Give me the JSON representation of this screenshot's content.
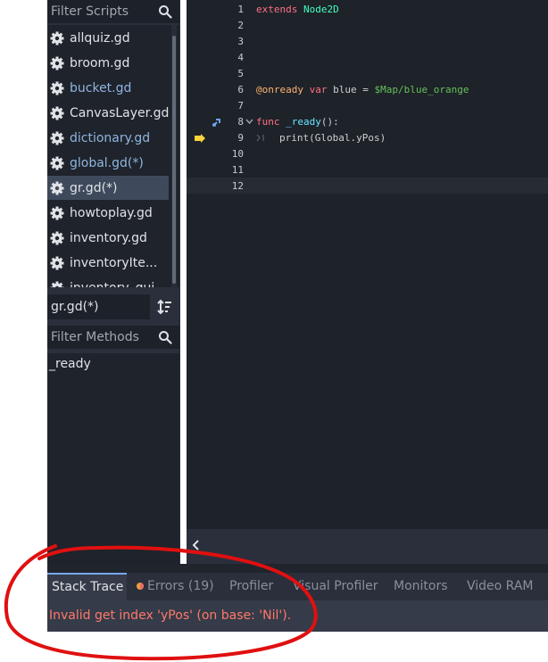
{
  "scripts_panel": {
    "filter_placeholder": "Filter Scripts",
    "items": [
      {
        "label": "allquiz.gd",
        "color": "white"
      },
      {
        "label": "broom.gd",
        "color": "white"
      },
      {
        "label": "bucket.gd",
        "color": "blue"
      },
      {
        "label": "CanvasLayer.gd",
        "color": "white"
      },
      {
        "label": "dictionary.gd",
        "color": "blue"
      },
      {
        "label": "global.gd(*)",
        "color": "blue"
      },
      {
        "label": "gr.gd(*)",
        "color": "white",
        "selected": true
      },
      {
        "label": "howtoplay.gd",
        "color": "white"
      },
      {
        "label": "inventory.gd",
        "color": "white"
      },
      {
        "label": "inventoryIte...",
        "color": "white"
      },
      {
        "label": "inventory_gui",
        "color": "white"
      }
    ],
    "current_script": "gr.gd(*)",
    "methods_filter_placeholder": "Filter Methods",
    "methods": [
      "_ready"
    ]
  },
  "editor": {
    "line_numbers": [
      "1",
      "2",
      "3",
      "4",
      "5",
      "6",
      "7",
      "8",
      "9",
      "10",
      "11",
      "12"
    ],
    "line1": {
      "kw": "extends",
      "cls": "Node2D"
    },
    "line6": {
      "annot": "@onready",
      "kw": "var",
      "name": "blue",
      "eq": "=",
      "path": "$Map/blue_orange"
    },
    "line8": {
      "kw": "func",
      "fname": "_ready",
      "rest": "():"
    },
    "line9": {
      "code": "print(Global.yPos)"
    }
  },
  "bottom_panel": {
    "tabs": [
      {
        "label": "Stack Trace",
        "active": true
      },
      {
        "label": "Errors (19)"
      },
      {
        "label": "Profiler"
      },
      {
        "label": "Visual Profiler"
      },
      {
        "label": "Monitors"
      },
      {
        "label": "Video RAM"
      }
    ],
    "error_message": "Invalid get index 'yPos' (on base: 'Nil')."
  },
  "colors": {
    "accent": "#77a7f0",
    "error_text": "#ff786b",
    "annotation_red": "#e01010"
  }
}
